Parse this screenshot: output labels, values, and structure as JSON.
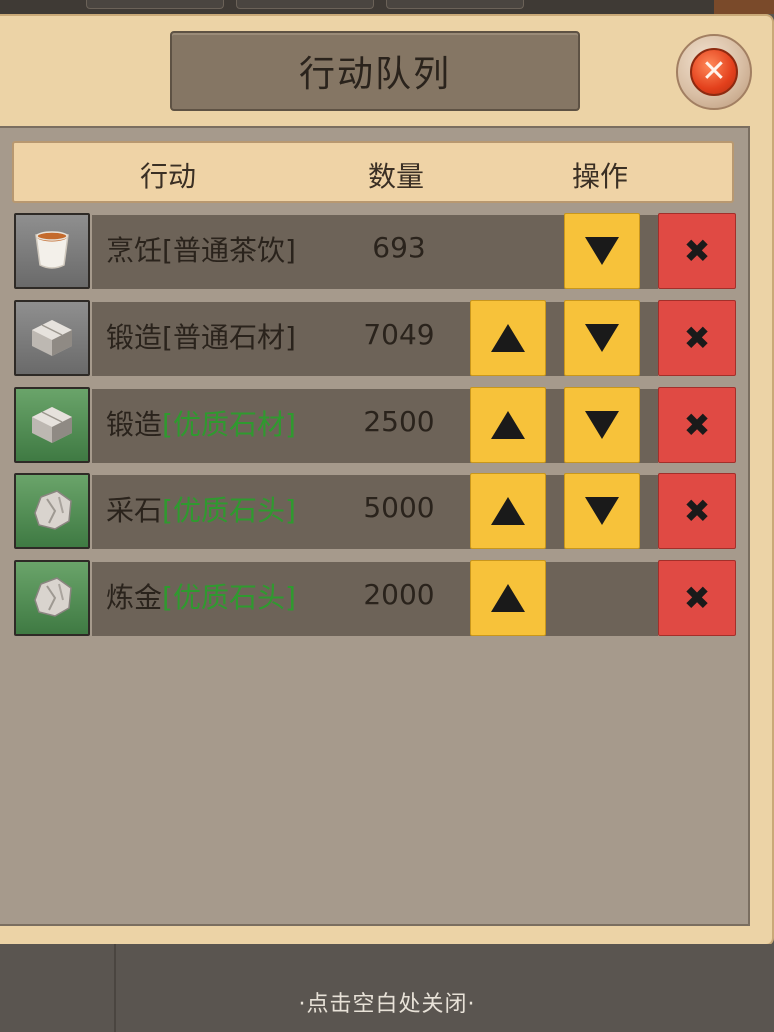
{
  "dialog": {
    "title": "行动队列",
    "close_icon": "close-x-icon"
  },
  "table": {
    "headers": {
      "action": "行动",
      "quantity": "数量",
      "operation": "操作"
    },
    "rows": [
      {
        "verb": "烹饪",
        "item": "[普通茶饮]",
        "quality": "normal",
        "quantity": "693",
        "icon": "tea-cup-icon",
        "icon_bg": "gray",
        "up": false,
        "down": true,
        "remove_label": "✖"
      },
      {
        "verb": "锻造",
        "item": "[普通石材]",
        "quality": "normal",
        "quantity": "7049",
        "icon": "stone-block-icon",
        "icon_bg": "gray",
        "up": true,
        "down": true,
        "remove_label": "✖"
      },
      {
        "verb": "锻造",
        "item": "[优质石材]",
        "quality": "good",
        "quantity": "2500",
        "icon": "stone-block-icon",
        "icon_bg": "green",
        "up": true,
        "down": true,
        "remove_label": "✖"
      },
      {
        "verb": "采石",
        "item": "[优质石头]",
        "quality": "good",
        "quantity": "5000",
        "icon": "rock-icon",
        "icon_bg": "green",
        "up": true,
        "down": true,
        "remove_label": "✖"
      },
      {
        "verb": "炼金",
        "item": "[优质石头]",
        "quality": "good",
        "quantity": "2000",
        "icon": "rock-icon",
        "icon_bg": "green",
        "up": true,
        "down": false,
        "remove_label": "✖"
      }
    ]
  },
  "footer": {
    "close_hint": "·点击空白处关闭·"
  },
  "colors": {
    "move_button": "#f7c23a",
    "remove_button": "#e04a44",
    "good_quality_text": "#2f9a2f"
  }
}
